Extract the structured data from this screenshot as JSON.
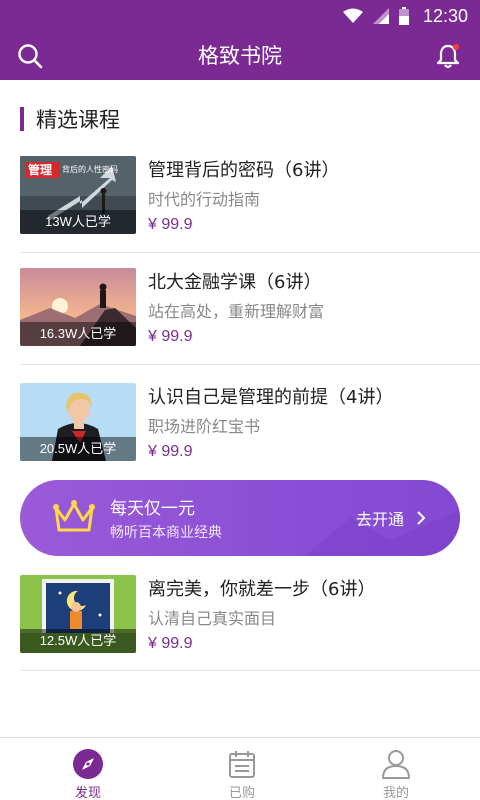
{
  "status_bar": {
    "time": "12:30"
  },
  "header": {
    "title": "格致书院"
  },
  "section": {
    "title": "精选课程"
  },
  "courses": [
    {
      "title": "管理背后的密码（6讲）",
      "subtitle": "时代的行动指南",
      "price": "¥ 99.9",
      "count": "13W人已学",
      "thumb_title": "管理",
      "thumb_sub": "背后的人性密码"
    },
    {
      "title": "北大金融学课（6讲）",
      "subtitle": "站在高处，重新理解财富",
      "price": "¥ 99.9",
      "count": "16.3W人已学"
    },
    {
      "title": "认识自己是管理的前提（4讲）",
      "subtitle": "职场进阶红宝书",
      "price": "¥ 99.9",
      "count": "20.5W人已学"
    },
    {
      "title": "离完美，你就差一步（6讲）",
      "subtitle": "认清自己真实面目",
      "price": "¥ 99.9",
      "count": "12.5W人已学"
    }
  ],
  "banner": {
    "title": "每天仅一元",
    "subtitle": "畅听百本商业经典",
    "action": "去开通"
  },
  "tabs": [
    {
      "label": "发现",
      "icon": "compass-icon",
      "active": true
    },
    {
      "label": "已购",
      "icon": "calendar-icon",
      "active": false
    },
    {
      "label": "我的",
      "icon": "user-icon",
      "active": false
    }
  ],
  "colors": {
    "primary": "#7b2a94",
    "banner": "#9b5bd8",
    "price": "#7b2a94"
  }
}
